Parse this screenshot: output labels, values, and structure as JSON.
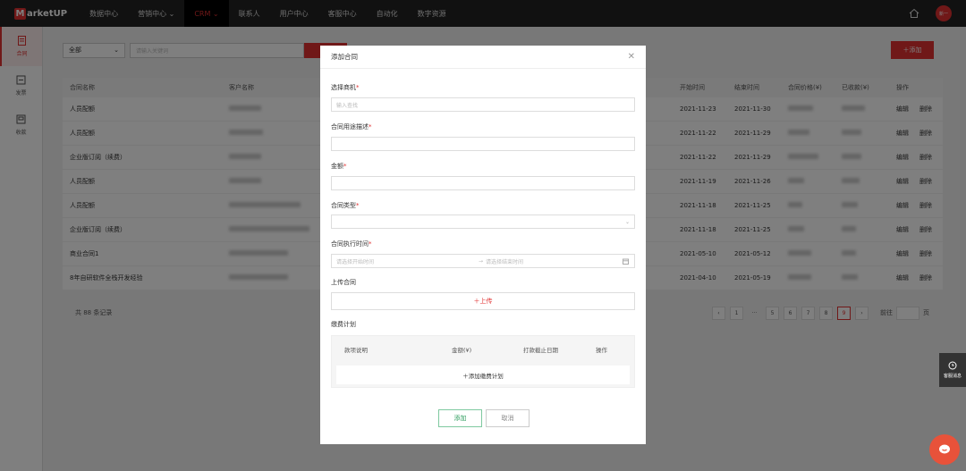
{
  "app": {
    "logo_text": "arketUP",
    "logo_letter": "M"
  },
  "nav": {
    "items": [
      "数据中心",
      "营销中心 ⌄",
      "CRM ⌄",
      "联系人",
      "用户中心",
      "客服中心",
      "自动化",
      "数字资源"
    ],
    "active_index": 2,
    "avatar_text": "新一"
  },
  "sidebar": {
    "items": [
      {
        "label": "合同",
        "icon": "contract-icon",
        "active": true
      },
      {
        "label": "发票",
        "icon": "invoice-icon",
        "active": false
      },
      {
        "label": "收款",
        "icon": "payment-icon",
        "active": false
      }
    ]
  },
  "filter": {
    "select_value": "全部",
    "search_placeholder": "请输入关键词",
    "add_label": "＋添加"
  },
  "table": {
    "headers": [
      "合同名称",
      "客户名称",
      "开始时间",
      "结束时间",
      "合同价格(¥)",
      "已收款(¥)",
      "操作"
    ],
    "rows": [
      {
        "name": "人员配额",
        "start": "2021-11-23",
        "end": "2021-11-30"
      },
      {
        "name": "人员配额",
        "start": "2021-11-22",
        "end": "2021-11-29"
      },
      {
        "name": "企业版订阅（续费）",
        "start": "2021-11-22",
        "end": "2021-11-29"
      },
      {
        "name": "人员配额",
        "start": "2021-11-19",
        "end": "2021-11-26"
      },
      {
        "name": "人员配额",
        "start": "2021-11-18",
        "end": "2021-11-25"
      },
      {
        "name": "企业版订阅（续费）",
        "start": "2021-11-18",
        "end": "2021-11-25"
      },
      {
        "name": "商业合同1",
        "start": "2021-05-10",
        "end": "2021-05-12"
      },
      {
        "name": "8年自研软件全栈开发经验",
        "start": "2021-04-10",
        "end": "2021-05-19"
      }
    ],
    "edit_label": "编辑",
    "delete_label": "删除"
  },
  "pager": {
    "total_text": "共 88 条记录",
    "pages": [
      "1",
      "···",
      "5",
      "6",
      "7",
      "8",
      "9"
    ],
    "active_page": "9",
    "goto_label": "前往",
    "page_unit": "页"
  },
  "modal": {
    "title": "添加合同",
    "fields": {
      "opportunity_label": "选择商机",
      "opportunity_placeholder": "输入查找",
      "usage_label": "合同用途描述",
      "amount_label": "金额",
      "type_label": "合同类型",
      "period_label": "合同执行时间",
      "start_placeholder": "请选择开始时间",
      "end_placeholder": "请选择结束时间",
      "upload_label": "上传合同",
      "upload_button": "＋上传",
      "plan_label": "缴费计划"
    },
    "plan_headers": [
      "款项说明",
      "金额(¥)",
      "打款截止日期",
      "操作"
    ],
    "plan_add": "＋添加缴费计划",
    "confirm_label": "添加",
    "cancel_label": "取消"
  },
  "widgets": {
    "service_label": "客服消息"
  },
  "colors": {
    "accent": "#e03131",
    "topbar": "#222222",
    "confirm": "#2e9d5e"
  }
}
